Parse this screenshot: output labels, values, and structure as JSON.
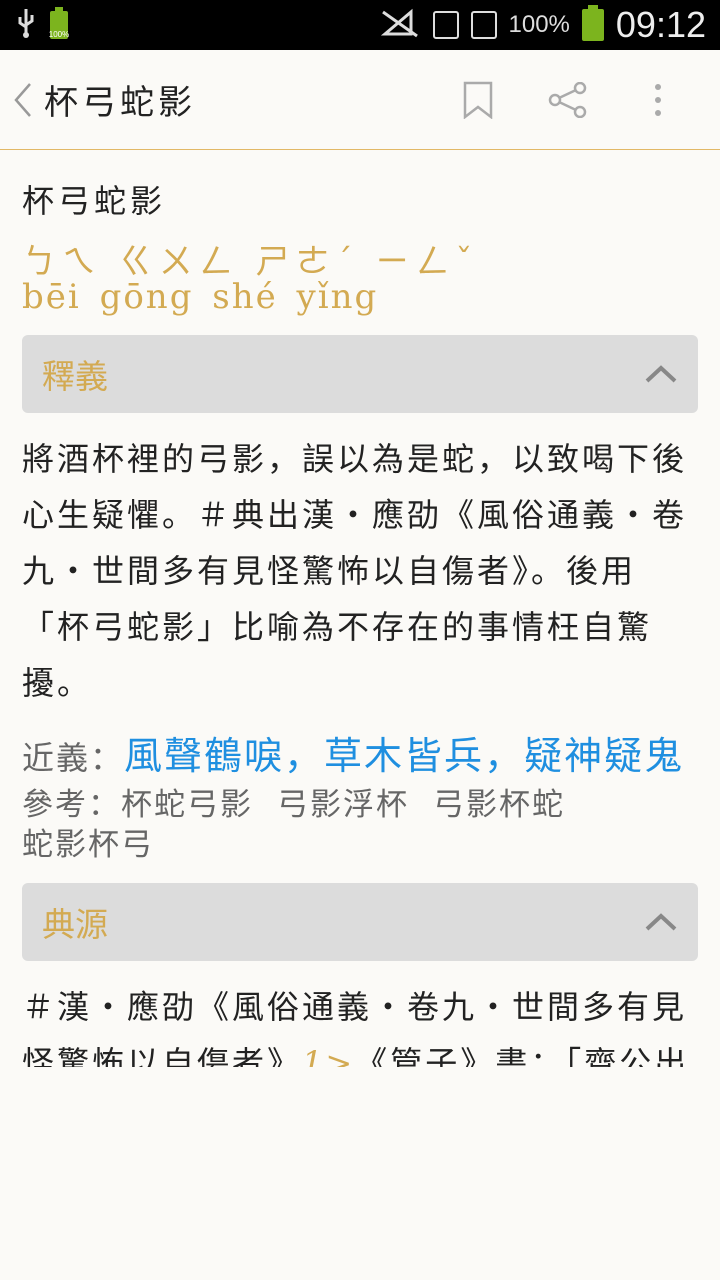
{
  "status_bar": {
    "battery_small_label": "100%",
    "battery_pct": "100%",
    "time": "09:12"
  },
  "app_bar": {
    "title": "杯弓蛇影"
  },
  "entry": {
    "headword": "杯弓蛇影",
    "zhuyin": "ㄅㄟ ㄍㄨㄥ ㄕㄜˊ ㄧㄥˇ",
    "pinyin": "bēi gōng shé yǐng"
  },
  "sections": [
    {
      "label": "釋義",
      "definition": "將酒杯裡的弓影，誤以為是蛇，以致喝下後心生疑懼。＃典出漢‧應劭《風俗通義‧卷九‧世間多有見怪驚怖以自傷者》。後用「杯弓蛇影」比喻為不存在的事情枉自驚擾。",
      "synonyms_label": "近義：",
      "synonyms": [
        "風聲鶴唳",
        "草木皆兵",
        "疑神疑鬼"
      ],
      "refs_label": "參考：",
      "refs": [
        "杯蛇弓影",
        "弓影浮杯",
        "弓影杯蛇",
        "蛇影杯弓"
      ]
    },
    {
      "label": "典源",
      "source_text_1": "＃漢‧應劭《風俗通義‧卷九‧世間多有見怪驚怖以自傷者》",
      "source_note": "1>",
      "source_text_2": "《管子》書：「齊公出於澤，見衣紫衣，大"
    }
  ]
}
